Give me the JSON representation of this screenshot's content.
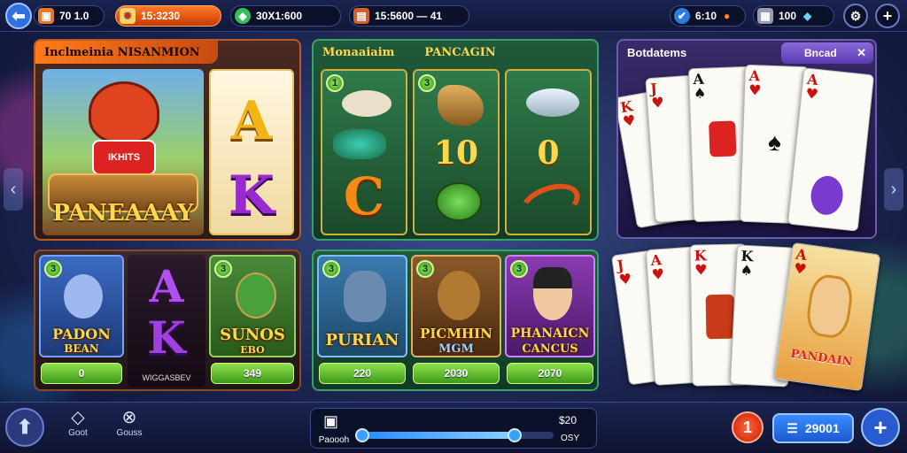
{
  "topbar": {
    "back_icon": "arrow-left-icon",
    "balance1": "70 1.0",
    "balance2": "15:3230",
    "balance3": "30X1:600",
    "balance4": "15:5600 — 41",
    "right_stat1": "6:10",
    "right_stat2": "100"
  },
  "panel_left": {
    "title": "Inclmeinia NISANMION",
    "feature_title": "PANEAAAY",
    "mascot_shirt": "IKHITS",
    "card_a": "A",
    "card_k": "K"
  },
  "panel_mid": {
    "title1": "Monaaiaim",
    "title2": "PANCAGIN",
    "slot1_badge": "1",
    "slot2_badge": "3",
    "slot2_value": "10",
    "slot3_value": "0",
    "reel_letter": "C"
  },
  "panel_right": {
    "title": "Botdatems",
    "tab_label": "Bncad",
    "close_label": "✕"
  },
  "games_left": [
    {
      "badge": "3",
      "title": "PADON",
      "subtitle": "BEAN",
      "button": "0"
    },
    {
      "letter_a": "A",
      "letter_k": "K",
      "caption": "WIGGASBEV"
    },
    {
      "badge": "3",
      "title": "SUNOS",
      "subtitle": "EBO",
      "button": "349"
    }
  ],
  "games_mid": [
    {
      "badge": "3",
      "title": "PURIAN",
      "button": "220"
    },
    {
      "badge": "3",
      "title": "PICMHIN",
      "subtitle": "MGM",
      "button": "2030"
    },
    {
      "badge": "3",
      "title": "PHANAICN",
      "subtitle": "CANCUS",
      "button": "2070"
    }
  ],
  "hand_card_caption": "PANDAIN",
  "bottombar": {
    "left1_label": "Goot",
    "left2_label": "Gouss",
    "progress_label": "Paoooh",
    "progress_value1": "$20",
    "progress_value2": "OSY",
    "progress_fraction": 0.8,
    "notif_count": "1",
    "chips_value": "29001"
  },
  "colors": {
    "accent": "#ff6a00",
    "green": "#5fbf2a",
    "panel_blue": "#1e2a5e"
  }
}
